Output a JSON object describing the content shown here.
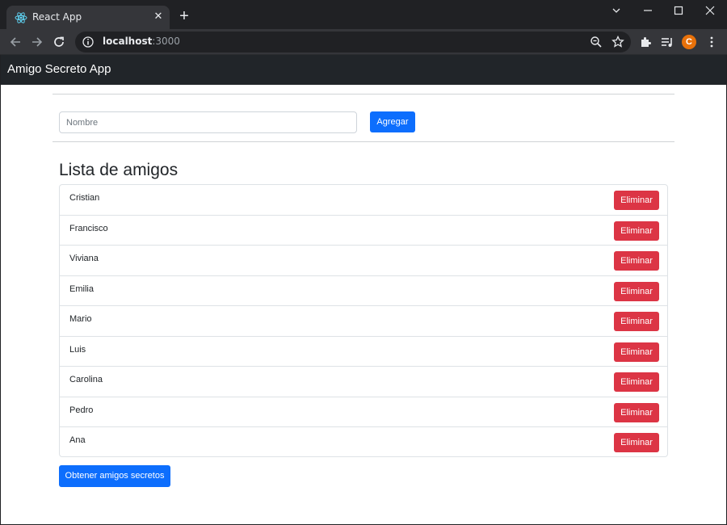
{
  "browser": {
    "tab_title": "React App",
    "url_host": "localhost",
    "url_port": ":3000",
    "profile_initial": "C",
    "new_tab_label": "+",
    "tab_close_label": "✕"
  },
  "app": {
    "title": "Amigo Secreto App"
  },
  "form": {
    "name_placeholder": "Nombre",
    "name_value": "",
    "add_label": "Agregar"
  },
  "list": {
    "heading": "Lista de amigos",
    "delete_label": "Eliminar",
    "friends": [
      "Cristian",
      "Francisco",
      "Viviana",
      "Emilia",
      "Mario",
      "Luis",
      "Carolina",
      "Pedro",
      "Ana"
    ]
  },
  "actions": {
    "secret_label": "Obtener amigos secretos"
  },
  "colors": {
    "primary": "#0d6efd",
    "danger": "#dc3545",
    "navbar": "#212529",
    "chrome_dark": "#202124",
    "chrome_toolbar": "#35363a",
    "profile": "#e8710a"
  }
}
